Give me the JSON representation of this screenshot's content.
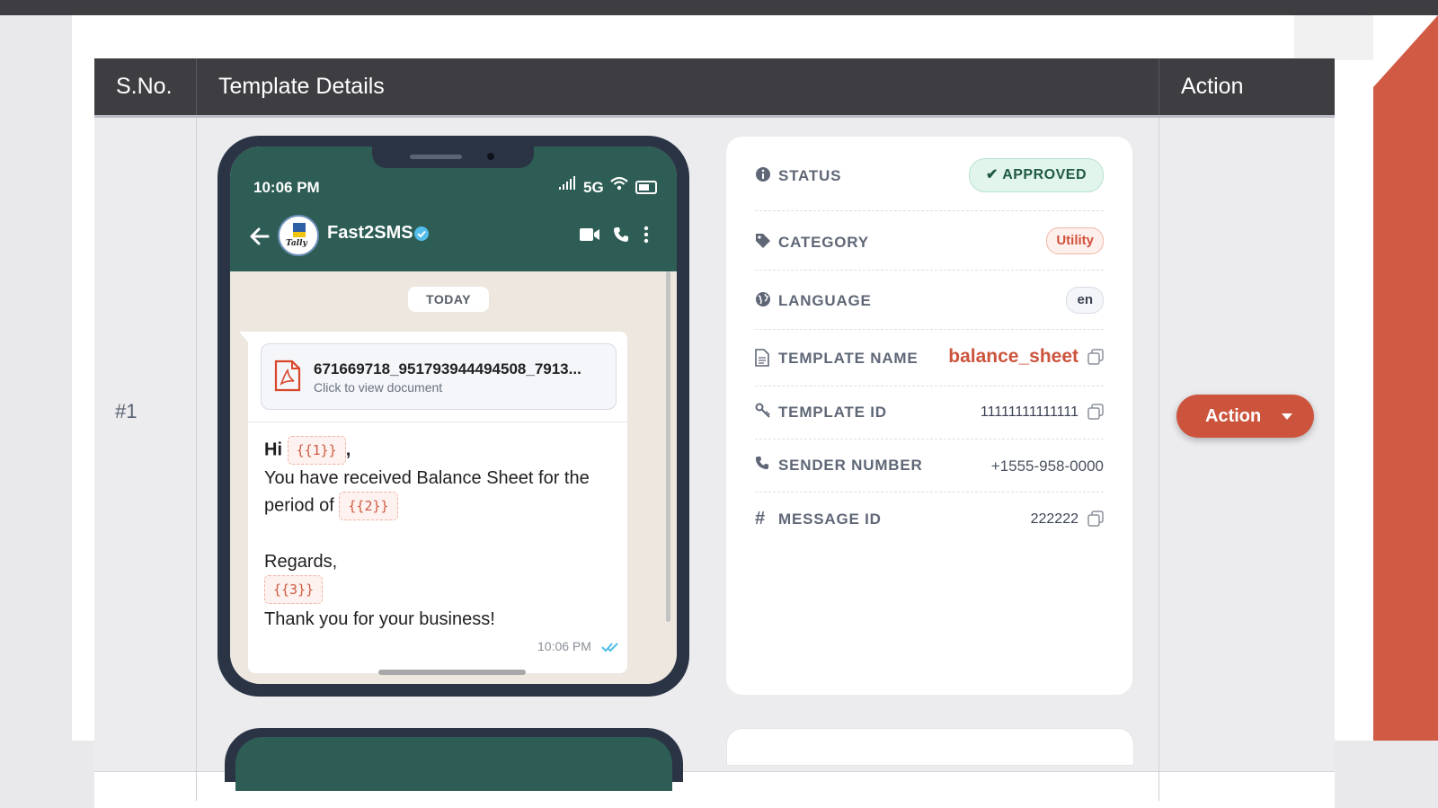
{
  "table": {
    "headers": {
      "sno": "S.No.",
      "details": "Template Details",
      "action": "Action"
    },
    "rows": [
      {
        "sno": "#1",
        "preview": {
          "status_time": "10:06 PM",
          "network": "5G",
          "contact_name": "Fast2SMS",
          "date_chip": "TODAY",
          "document": {
            "name": "671669718_951793944494508_7913...",
            "subtitle": "Click to view document"
          },
          "message": {
            "line1_prefix": "Hi",
            "var1": "{{1}}",
            "line1_suffix": ",",
            "line2": "You have received Balance Sheet for the",
            "line3_prefix": "period of",
            "var2": "{{2}}",
            "line4": "Regards,",
            "var3": "{{3}}",
            "line5": "Thank you for your business!"
          },
          "message_time": "10:06 PM"
        },
        "details": {
          "status": {
            "label": "STATUS",
            "value": "APPROVED"
          },
          "category": {
            "label": "CATEGORY",
            "value": "Utility"
          },
          "language": {
            "label": "LANGUAGE",
            "value": "en"
          },
          "template_name": {
            "label": "TEMPLATE NAME",
            "value": "balance_sheet"
          },
          "template_id": {
            "label": "TEMPLATE ID",
            "value": "11111111111111"
          },
          "sender_number": {
            "label": "SENDER NUMBER",
            "value": "+1555-958-0000"
          },
          "message_id": {
            "label": "MESSAGE ID",
            "value": "222222"
          }
        },
        "action_label": "Action"
      }
    ]
  },
  "icons": {
    "status": "info-icon",
    "category": "tag-icon",
    "language": "globe-icon",
    "template_name": "file-icon",
    "template_id": "key-icon",
    "sender_number": "phone-icon",
    "message_id": "hash-icon",
    "copy": "copy-icon",
    "document": "pdf-icon"
  },
  "colors": {
    "header_bg": "#3e3e42",
    "accent": "#cc543d",
    "whatsapp_header": "#2d5d54",
    "approved_bg": "#e2f5ec",
    "approved_text": "#1f5b42"
  }
}
